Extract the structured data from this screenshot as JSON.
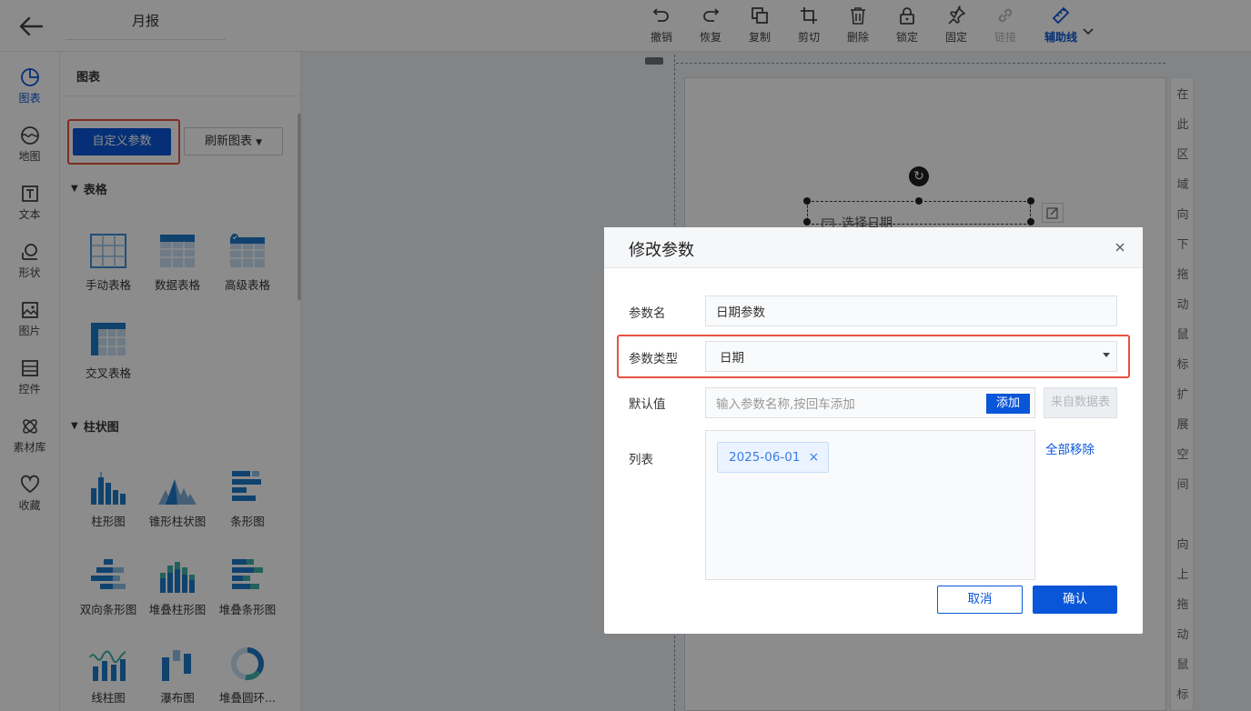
{
  "header": {
    "report_title": "月报",
    "toolbar": [
      {
        "label": "撤销",
        "icon": "undo-icon"
      },
      {
        "label": "恢复",
        "icon": "redo-icon"
      },
      {
        "label": "复制",
        "icon": "copy-icon"
      },
      {
        "label": "剪切",
        "icon": "crop-icon"
      },
      {
        "label": "删除",
        "icon": "delete-icon"
      },
      {
        "label": "锁定",
        "icon": "lock-icon"
      },
      {
        "label": "固定",
        "icon": "pin-icon"
      },
      {
        "label": "链接",
        "icon": "link-icon",
        "disabled": true
      },
      {
        "label": "辅助线",
        "icon": "ruler-icon",
        "active": true
      }
    ]
  },
  "nav": {
    "items": [
      {
        "label": "图表",
        "icon": "chart-icon",
        "active": true
      },
      {
        "label": "地图",
        "icon": "map-icon"
      },
      {
        "label": "文本",
        "icon": "text-icon"
      },
      {
        "label": "形状",
        "icon": "shape-icon"
      },
      {
        "label": "图片",
        "icon": "image-icon"
      },
      {
        "label": "控件",
        "icon": "control-icon"
      },
      {
        "label": "素材库",
        "icon": "material-icon"
      },
      {
        "label": "收藏",
        "icon": "heart-icon"
      }
    ]
  },
  "panel": {
    "title": "图表",
    "custom_param_button": "自定义参数",
    "refresh_button": "刷新图表",
    "sections": {
      "table": "表格",
      "bar": "柱状图"
    },
    "table_items": [
      "手动表格",
      "数据表格",
      "高级表格",
      "交叉表格"
    ],
    "bar_items": [
      "柱形图",
      "锥形柱状图",
      "条形图",
      "双向条形图",
      "堆叠柱形图",
      "堆叠条形图",
      "线柱图",
      "瀑布图",
      "堆叠圆环..."
    ]
  },
  "canvas": {
    "widget_label": "选择日期",
    "side_hint_top": [
      "在",
      "此",
      "区",
      "域",
      "向",
      "下",
      "拖",
      "动",
      "鼠",
      "标",
      "扩",
      "展",
      "空",
      "间"
    ],
    "side_hint_bottom": [
      "向",
      "上",
      "拖",
      "动",
      "鼠",
      "标"
    ]
  },
  "dialog": {
    "title": "修改参数",
    "param_name_label": "参数名",
    "param_name_value": "日期参数",
    "param_type_label": "参数类型",
    "param_type_value": "日期",
    "default_label": "默认值",
    "default_placeholder": "输入参数名称,按回车添加",
    "add_button": "添加",
    "from_table_button": "来自数据表",
    "list_label": "列表",
    "list_tags": [
      "2025-06-01"
    ],
    "remove_all": "全部移除",
    "cancel": "取消",
    "confirm": "确认"
  },
  "colors": {
    "accent": "#0a56d8",
    "highlight": "#e8523f"
  }
}
